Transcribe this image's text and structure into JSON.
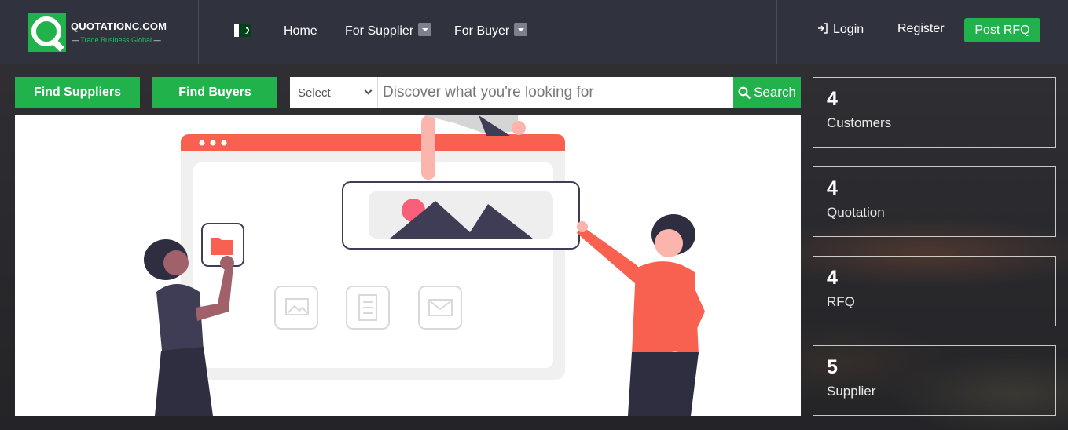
{
  "header": {
    "logo_title": "QUOTATIONC.COM",
    "logo_tagline": "Trade Business Global",
    "nav": {
      "home": "Home",
      "for_supplier": "For Supplier",
      "for_buyer": "For Buyer"
    },
    "login": "Login",
    "register": "Register",
    "post_rfq": "Post RFQ"
  },
  "search": {
    "find_suppliers": "Find Suppliers",
    "find_buyers": "Find Buyers",
    "select_value": "Select",
    "placeholder": "Discover what you're looking for",
    "button": "Search"
  },
  "stats": [
    {
      "value": "4",
      "label": "Customers"
    },
    {
      "value": "4",
      "label": "Quotation"
    },
    {
      "value": "4",
      "label": "RFQ"
    },
    {
      "value": "5",
      "label": "Supplier"
    }
  ],
  "colors": {
    "brand_green": "#22b24c",
    "header_bg": "#30333e",
    "accent_red": "#f8604f"
  }
}
